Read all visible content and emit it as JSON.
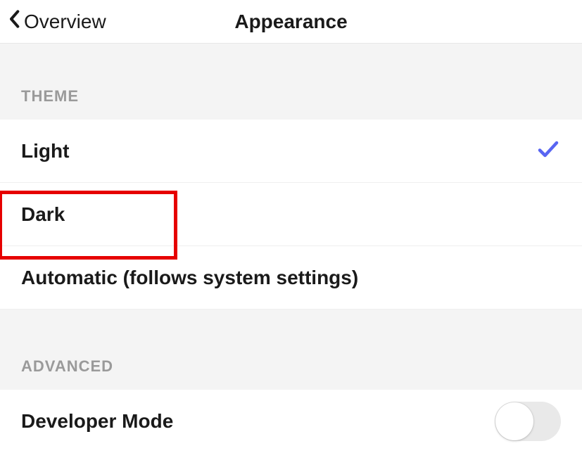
{
  "header": {
    "back_label": "Overview",
    "title": "Appearance"
  },
  "sections": {
    "theme": {
      "heading": "THEME",
      "options": {
        "light": {
          "label": "Light",
          "selected": true
        },
        "dark": {
          "label": "Dark",
          "selected": false
        },
        "automatic": {
          "label": "Automatic (follows system settings)",
          "selected": false
        }
      }
    },
    "advanced": {
      "heading": "ADVANCED",
      "developer_mode": {
        "label": "Developer Mode",
        "enabled": false
      }
    }
  },
  "annotation": {
    "target": "theme-option-dark",
    "color": "#e60000"
  }
}
